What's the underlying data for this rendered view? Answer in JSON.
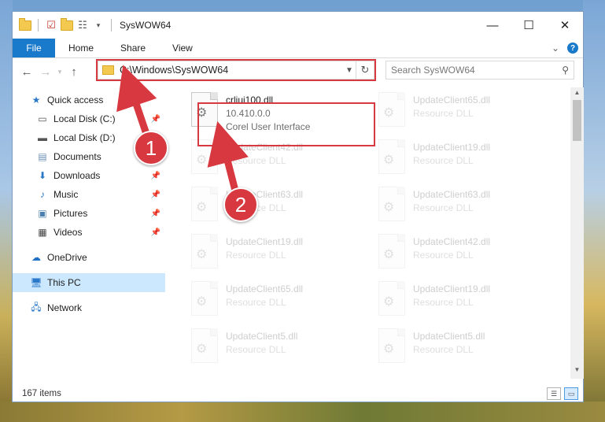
{
  "window": {
    "title": "SysWOW64",
    "minimize_glyph": "—",
    "maximize_glyph": "☐",
    "close_glyph": "✕"
  },
  "ribbon": {
    "file_label": "File",
    "tabs": [
      "Home",
      "Share",
      "View"
    ],
    "expand_glyph": "⌄",
    "help_glyph": "?"
  },
  "address": {
    "path": "C:\\Windows\\SysWOW64",
    "search_placeholder": "Search SysWOW64"
  },
  "nav": {
    "items": [
      {
        "label": "Quick access",
        "icon": "star-icon",
        "pinned": false
      },
      {
        "label": "Local Disk (C:)",
        "icon": "drive-icon",
        "pinned": true
      },
      {
        "label": "Local Disk (D:)",
        "icon": "drive-icon",
        "pinned": true
      },
      {
        "label": "Documents",
        "icon": "documents-icon",
        "pinned": true
      },
      {
        "label": "Downloads",
        "icon": "download-icon",
        "pinned": true
      },
      {
        "label": "Music",
        "icon": "music-icon",
        "pinned": true
      },
      {
        "label": "Pictures",
        "icon": "pictures-icon",
        "pinned": true
      },
      {
        "label": "Videos",
        "icon": "videos-icon",
        "pinned": true
      },
      {
        "label": "OneDrive",
        "icon": "cloud-icon",
        "pinned": false
      },
      {
        "label": "This PC",
        "icon": "computer-icon",
        "pinned": false,
        "selected": true
      },
      {
        "label": "Network",
        "icon": "network-icon",
        "pinned": false
      }
    ]
  },
  "files": [
    {
      "name": "crliui100.dll",
      "line2": "10.410.0.0",
      "line3": "Corel User Interface",
      "highlight": true
    },
    {
      "name": "UpdateClient65.dll",
      "line2": "Resource DLL"
    },
    {
      "name": "UpdateClient42.dll",
      "line2": "Resource DLL"
    },
    {
      "name": "UpdateClient19.dll",
      "line2": "Resource DLL"
    },
    {
      "name": "UpdateClient63.dll",
      "line2": "Resource DLL"
    },
    {
      "name": "UpdateClient63.dll",
      "line2": "Resource DLL"
    },
    {
      "name": "UpdateClient19.dll",
      "line2": "Resource DLL"
    },
    {
      "name": "UpdateClient42.dll",
      "line2": "Resource DLL"
    },
    {
      "name": "UpdateClient65.dll",
      "line2": "Resource DLL"
    },
    {
      "name": "UpdateClient19.dll",
      "line2": "Resource DLL"
    },
    {
      "name": "UpdateClient5.dll",
      "line2": "Resource DLL"
    },
    {
      "name": "UpdateClient5.dll",
      "line2": "Resource DLL"
    }
  ],
  "status": {
    "item_count": "167 items"
  },
  "annotations": {
    "badge1": "1",
    "badge2": "2",
    "color": "#d8383f"
  }
}
